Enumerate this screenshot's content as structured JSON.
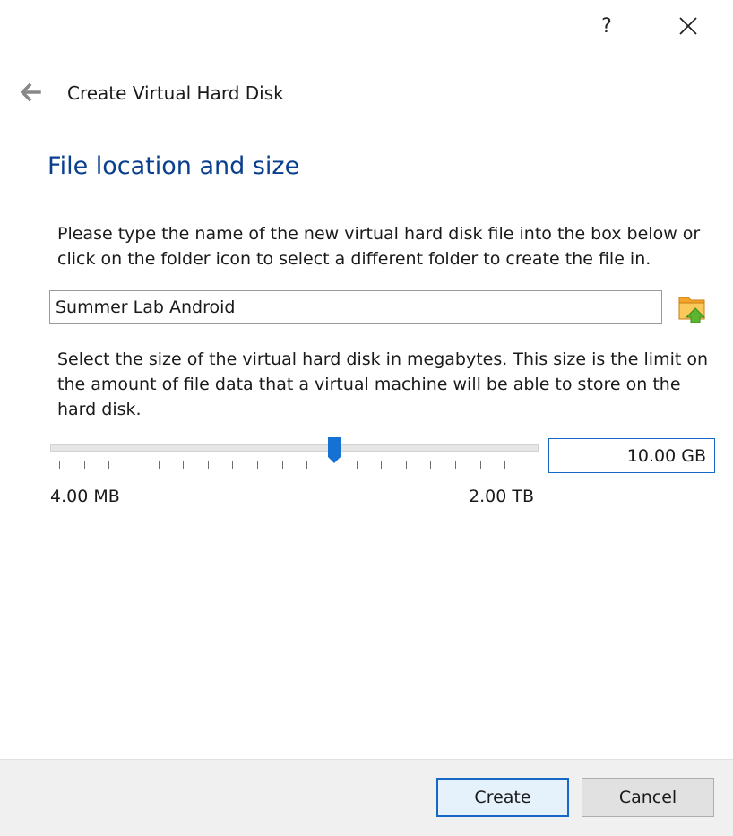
{
  "titlebar": {
    "help_label": "?",
    "close_label": "✕"
  },
  "wizard": {
    "title": "Create Virtual Hard Disk"
  },
  "page": {
    "heading": "File location and size",
    "location_description": "Please type the name of the new virtual hard disk file into the box below or click on the folder icon to select a different folder to create the file in.",
    "file_name": "Summer Lab Android",
    "size_description": "Select the size of the virtual hard disk in megabytes. This size is the limit on the amount of file data that a virtual machine will be able to store on the hard disk.",
    "size_value": "10.00 GB",
    "slider_min_label": "4.00 MB",
    "slider_max_label": "2.00 TB",
    "slider_position_fraction": 0.585,
    "slider_tick_count": 20
  },
  "footer": {
    "create_label": "Create",
    "cancel_label": "Cancel"
  },
  "icons": {
    "back": "back-arrow-icon",
    "folder": "folder-browse-icon",
    "close": "close-icon",
    "help": "help-icon"
  },
  "colors": {
    "heading": "#0a3f8e",
    "accent": "#1768c6",
    "thumb": "#1572d3"
  }
}
